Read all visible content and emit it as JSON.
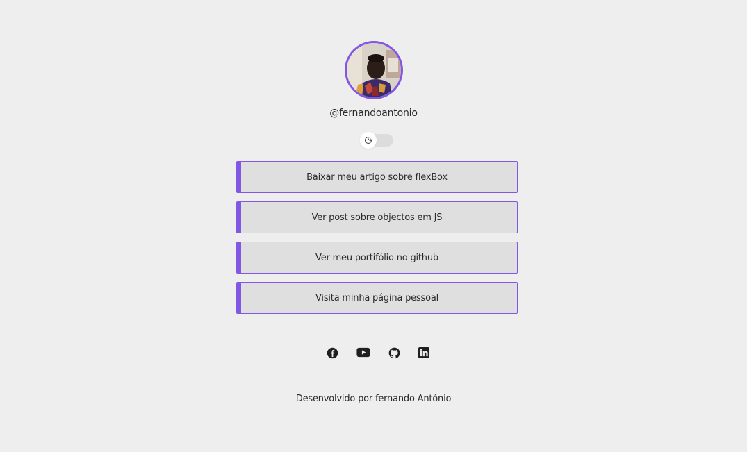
{
  "profile": {
    "username": "@fernandoantonio",
    "avatar_alt": "profile photo"
  },
  "theme_toggle": {
    "icon": "moon-icon",
    "state": "off"
  },
  "links": [
    {
      "label": "Baixar meu artigo sobre flexBox"
    },
    {
      "label": "Ver post sobre objectos em JS"
    },
    {
      "label": "Ver meu portifólio no github"
    },
    {
      "label": "Visita minha página pessoal"
    }
  ],
  "social": [
    {
      "name": "facebook-icon"
    },
    {
      "name": "youtube-icon"
    },
    {
      "name": "github-icon"
    },
    {
      "name": "linkedin-icon"
    }
  ],
  "footer": {
    "text": "Desenvolvido por fernando António"
  },
  "colors": {
    "accent": "#8257e5",
    "background": "#eeeeee",
    "button_bg": "#dfdfe0",
    "text": "#2a2a2a"
  }
}
